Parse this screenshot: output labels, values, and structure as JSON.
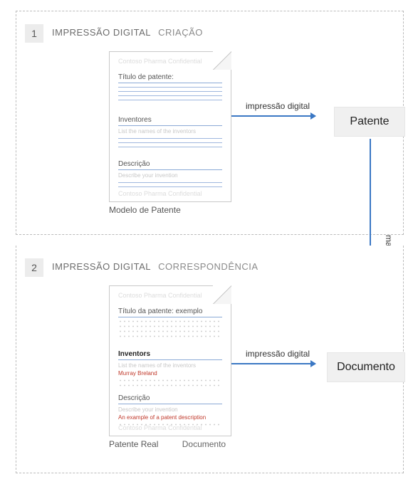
{
  "panel1": {
    "step": "1",
    "heading_prefix": "IMPRESSÃO DIGITAL",
    "heading_suffix": "CRIAÇÃO",
    "doc": {
      "watermark": "Contoso Pharma Confidential",
      "title_label": "Título de patente:",
      "inventors_label": "Inventores",
      "inventors_hint": "List the names of the inventors",
      "desc_label": "Descrição",
      "desc_hint": "Describe your invention"
    },
    "caption": "Modelo de Patente",
    "arrow_label": "impressão digital",
    "box_label": "Patente"
  },
  "matches_label": "matches",
  "panel2": {
    "step": "2",
    "heading_prefix": "IMPRESSÃO DIGITAL",
    "heading_suffix": "CORRESPONDÊNCIA",
    "doc": {
      "watermark": "Contoso Pharma Confidential",
      "title_label": "Título da patente: exemplo",
      "inventors_label": "Inventors",
      "inventors_hint": "List the names of the inventors",
      "inventors_value": "Murray Breland",
      "desc_label": "Descrição",
      "desc_hint": "Describe your invention",
      "desc_value": "An example of a patent description"
    },
    "caption_main": "Patente Real",
    "caption_minor": "Documento",
    "arrow_label": "impressão digital",
    "box_label": "Documento"
  }
}
